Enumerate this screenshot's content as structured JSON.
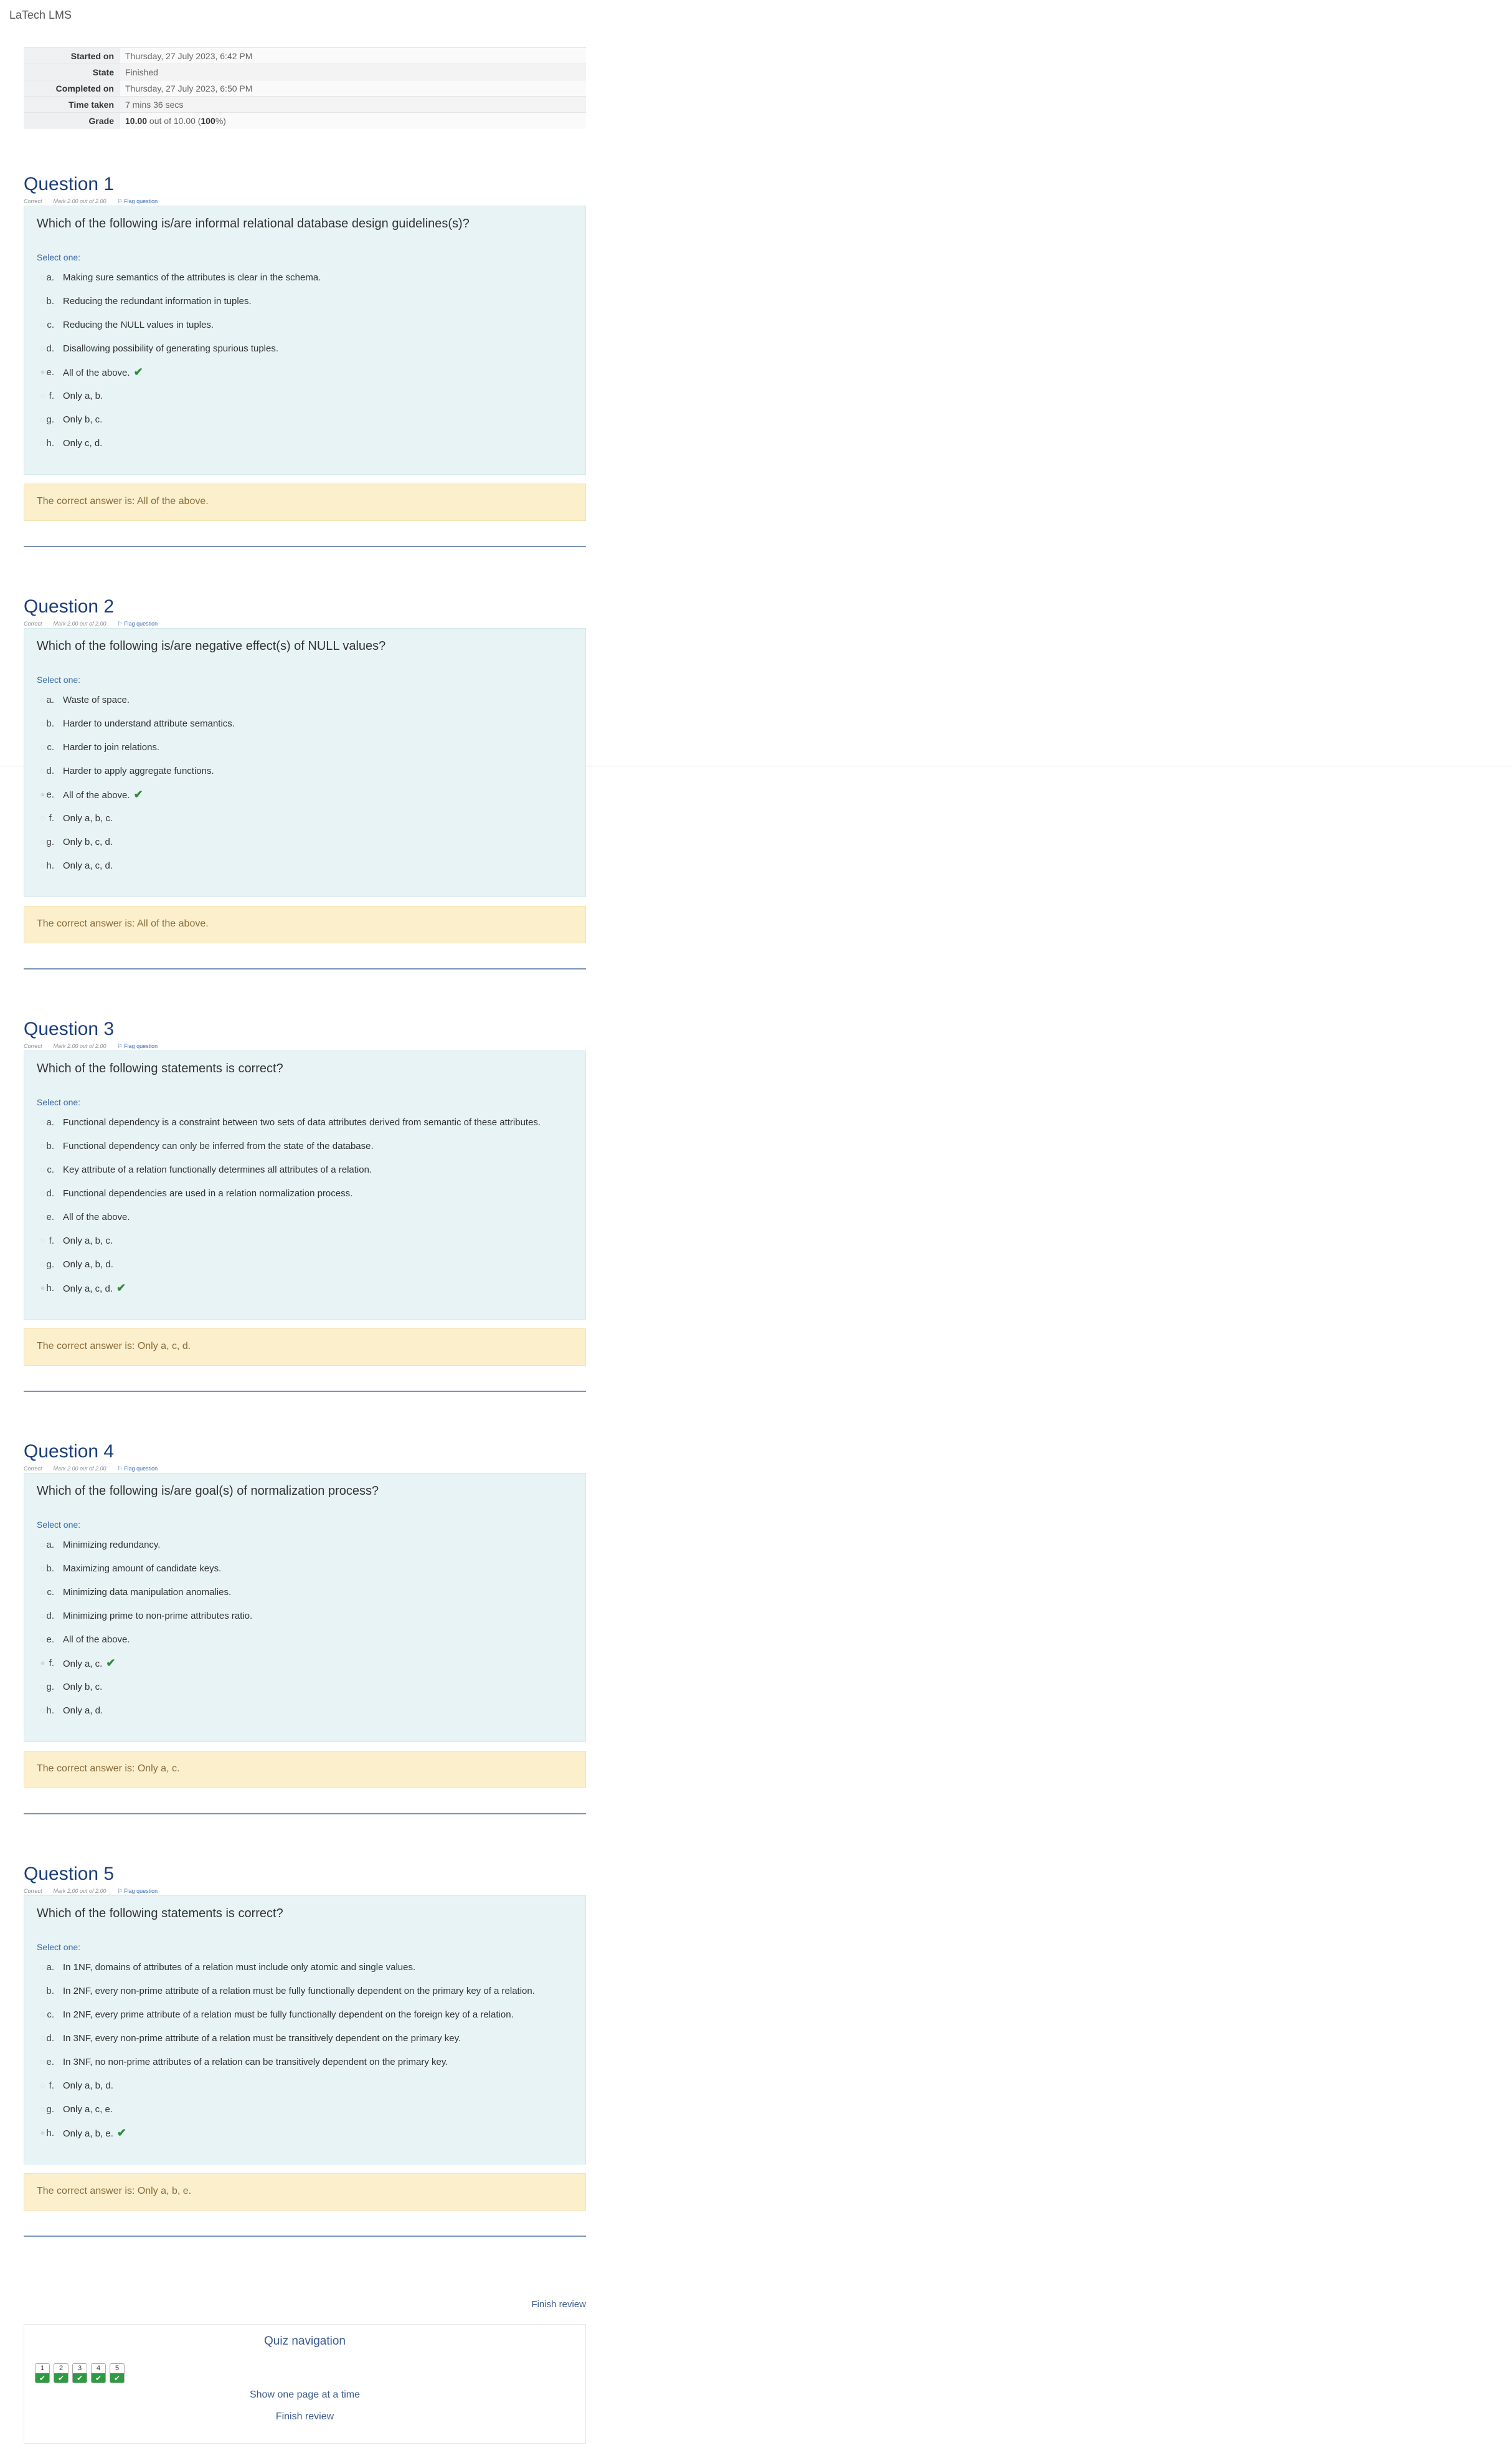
{
  "site_name": "LaTech LMS",
  "summary": [
    {
      "label": "Started on",
      "value": "Thursday, 27 July 2023, 6:42 PM"
    },
    {
      "label": "State",
      "value": "Finished"
    },
    {
      "label": "Completed on",
      "value": "Thursday, 27 July 2023, 6:50 PM"
    },
    {
      "label": "Time taken",
      "value": "7 mins 36 secs"
    },
    {
      "label": "Grade",
      "grade_score": "10.00",
      "grade_mid": " out of 10.00 (",
      "grade_pct": "100",
      "grade_end": "%)"
    }
  ],
  "questions": [
    {
      "title": "Question 1",
      "status": "Correct",
      "mark": "Mark 2.00 out of 2.00",
      "flag": "Flag question",
      "text": "Which of the following is/are informal relational database design guidelines(s)?",
      "select_label": "Select one:",
      "options": [
        {
          "letter": "a.",
          "text": "Making sure semantics of the attributes is clear in the schema."
        },
        {
          "letter": "b.",
          "text": "Reducing the redundant information in tuples."
        },
        {
          "letter": "c.",
          "text": "Reducing the NULL values in tuples."
        },
        {
          "letter": "d.",
          "text": "Disallowing possibility of generating spurious tuples."
        },
        {
          "letter": "e.",
          "text": "All of the above.",
          "selected": true
        },
        {
          "letter": "f.",
          "text": "Only a, b."
        },
        {
          "letter": "g.",
          "text": "Only b, c."
        },
        {
          "letter": "h.",
          "text": "Only c, d."
        }
      ],
      "feedback": "The correct answer is: All of the above."
    },
    {
      "title": "Question 2",
      "status": "Correct",
      "mark": "Mark 2.00 out of 2.00",
      "flag": "Flag question",
      "text": "Which of the following is/are negative effect(s) of NULL values?",
      "select_label": "Select one:",
      "options": [
        {
          "letter": "a.",
          "text": "Waste of space."
        },
        {
          "letter": "b.",
          "text": "Harder to understand attribute semantics."
        },
        {
          "letter": "c.",
          "text": "Harder to join relations."
        },
        {
          "letter": "d.",
          "text": "Harder to apply aggregate functions."
        },
        {
          "letter": "e.",
          "text": "All of the above.",
          "selected": true
        },
        {
          "letter": "f.",
          "text": "Only a, b, c."
        },
        {
          "letter": "g.",
          "text": "Only b, c, d."
        },
        {
          "letter": "h.",
          "text": "Only a, c, d."
        }
      ],
      "feedback": "The correct answer is: All of the above."
    },
    {
      "title": "Question 3",
      "status": "Correct",
      "mark": "Mark 2.00 out of 2.00",
      "flag": "Flag question",
      "text": "Which of the following statements is correct?",
      "select_label": "Select one:",
      "options": [
        {
          "letter": "a.",
          "text": "Functional dependency is a constraint between two sets of data attributes derived from semantic of these attributes."
        },
        {
          "letter": "b.",
          "text": "Functional dependency can only be inferred from the state of the database."
        },
        {
          "letter": "c.",
          "text": "Key attribute of a relation functionally determines all attributes of a relation."
        },
        {
          "letter": "d.",
          "text": "Functional dependencies are used in a relation normalization process."
        },
        {
          "letter": "e.",
          "text": "All of the above."
        },
        {
          "letter": "f.",
          "text": "Only a, b, c."
        },
        {
          "letter": "g.",
          "text": "Only a, b, d."
        },
        {
          "letter": "h.",
          "text": "Only a, c, d.",
          "selected": true
        }
      ],
      "feedback": "The correct answer is: Only a, c, d."
    },
    {
      "title": "Question 4",
      "status": "Correct",
      "mark": "Mark 2.00 out of 2.00",
      "flag": "Flag question",
      "text": "Which of the following is/are goal(s) of normalization process?",
      "select_label": "Select one:",
      "options": [
        {
          "letter": "a.",
          "text": "Minimizing redundancy."
        },
        {
          "letter": "b.",
          "text": "Maximizing amount of candidate keys."
        },
        {
          "letter": "c.",
          "text": "Minimizing data manipulation anomalies."
        },
        {
          "letter": "d.",
          "text": "Minimizing prime to non-prime attributes ratio."
        },
        {
          "letter": "e.",
          "text": "All of the above."
        },
        {
          "letter": "f.",
          "text": "Only a, c.",
          "selected": true
        },
        {
          "letter": "g.",
          "text": "Only b, c."
        },
        {
          "letter": "h.",
          "text": "Only a, d."
        }
      ],
      "feedback": "The correct answer is: Only a, c."
    },
    {
      "title": "Question 5",
      "status": "Correct",
      "mark": "Mark 2.00 out of 2.00",
      "flag": "Flag question",
      "text": "Which of the following statements is correct?",
      "select_label": "Select one:",
      "options": [
        {
          "letter": "a.",
          "text": "In 1NF, domains of attributes of a relation must include only atomic and single values."
        },
        {
          "letter": "b.",
          "text": "In 2NF, every non-prime attribute of a relation must be fully functionally dependent on the primary key of a relation."
        },
        {
          "letter": "c.",
          "text": "In 2NF, every prime attribute of a relation must be fully functionally dependent on the foreign key of a relation."
        },
        {
          "letter": "d.",
          "text": "In 3NF, every non-prime attribute of a relation must be transitively dependent on the primary key."
        },
        {
          "letter": "e.",
          "text": "In 3NF, no non-prime attributes of a relation can be transitively dependent on the primary key."
        },
        {
          "letter": "f.",
          "text": "Only a, b, d."
        },
        {
          "letter": "g.",
          "text": "Only a, c, e."
        },
        {
          "letter": "h.",
          "text": "Only a, b, e.",
          "selected": true
        }
      ],
      "feedback": "The correct answer is: Only a, b, e."
    }
  ],
  "finish_review_top": "Finish review",
  "quiz_nav": {
    "title": "Quiz navigation",
    "buttons": [
      "1",
      "2",
      "3",
      "4",
      "5"
    ],
    "button_state_icon": "check-icon",
    "show_one_page": "Show one page at a time",
    "finish_review": "Finish review"
  },
  "colors": {
    "question_bg": "#e7f3f5",
    "feedback_bg": "#fcefcc",
    "correct_green": "#2e8b3a",
    "title_blue": "#1a3f7a"
  }
}
